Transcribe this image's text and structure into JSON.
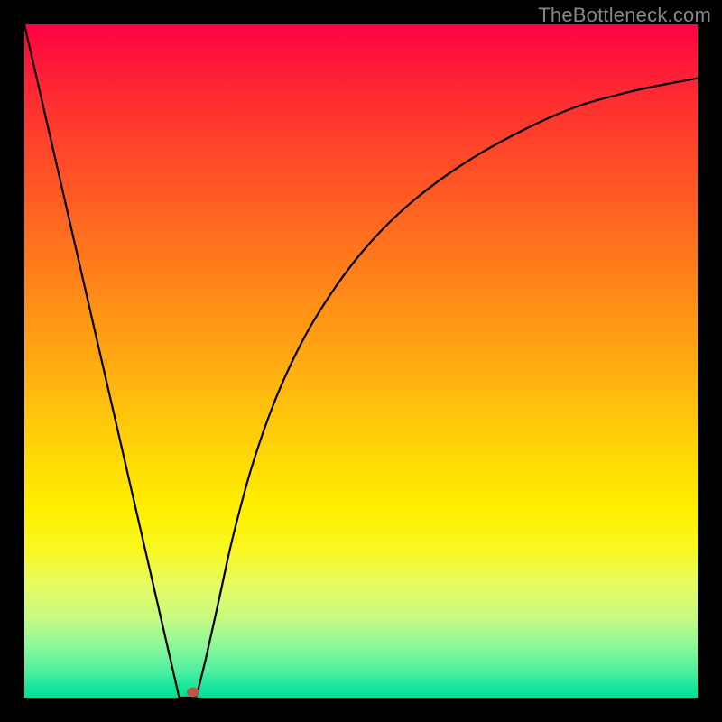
{
  "watermark": "TheBottleneck.com",
  "colors": {
    "background": "#000000",
    "curve_stroke": "#000000",
    "marker_fill": "#B55A4A",
    "gradient_top": "#FF0044",
    "gradient_bottom": "#00E090"
  },
  "chart_data": {
    "type": "line",
    "title": "",
    "xlabel": "",
    "ylabel": "",
    "xlim": [
      0,
      100
    ],
    "ylim": [
      0,
      100
    ],
    "grid": false,
    "legend": false,
    "background_gradient": {
      "orientation": "vertical",
      "stops": [
        {
          "pos": 0.0,
          "color": "#FF0044"
        },
        {
          "pos": 0.3,
          "color": "#FF6A20"
        },
        {
          "pos": 0.62,
          "color": "#FFD208"
        },
        {
          "pos": 0.78,
          "color": "#F8F820"
        },
        {
          "pos": 0.92,
          "color": "#90F898"
        },
        {
          "pos": 1.0,
          "color": "#00E090"
        }
      ]
    },
    "series": [
      {
        "name": "bottleneck-curve",
        "segments": [
          {
            "kind": "line",
            "x": [
              0,
              23
            ],
            "y": [
              100,
              0
            ]
          },
          {
            "kind": "line",
            "x": [
              23,
              25.5
            ],
            "y": [
              0,
              0
            ]
          },
          {
            "kind": "curve",
            "x": [
              25.5,
              27,
              29,
              31,
              34,
              38,
              43,
              50,
              58,
              68,
              80,
              90,
              100
            ],
            "y": [
              0,
              6,
              15,
              24,
              35,
              46,
              56,
              66,
              74,
              81,
              87,
              90,
              92
            ]
          }
        ]
      }
    ],
    "marker": {
      "x": 25,
      "y": 0.8,
      "color": "#B55A4A",
      "shape": "ellipse"
    }
  }
}
